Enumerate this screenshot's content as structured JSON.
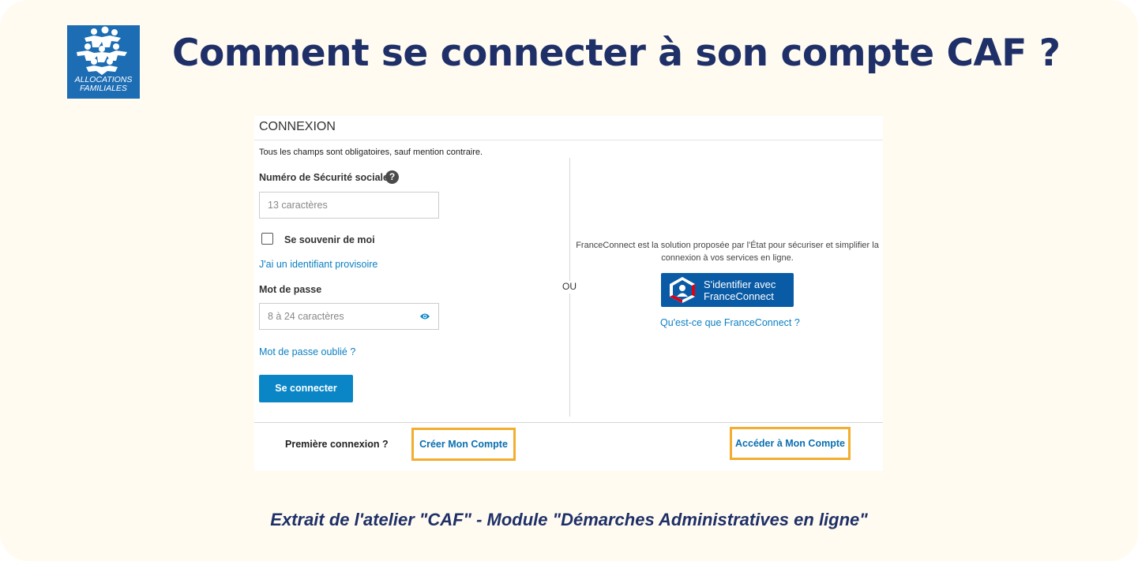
{
  "logo": {
    "line1": "ALLOCATIONS",
    "line2": "FAMILIALES",
    "brand_color": "#1d6db4"
  },
  "headline": "Comment se connecter à son compte CAF ?",
  "login": {
    "title": "CONNEXION",
    "mandatory_note": "Tous les champs sont obligatoires, sauf mention contraire.",
    "ssn_label": "Numéro de Sécurité sociale",
    "ssn_placeholder": "13 caractères",
    "help_icon": "question-circle-icon",
    "remember_label": "Se souvenir de moi",
    "temp_id_link": "J'ai un identifiant provisoire",
    "password_label": "Mot de passe",
    "password_placeholder": "8 à 24 caractères",
    "password_icon": "eye-icon",
    "forgot_link": "Mot de passe oublié ?",
    "submit_label": "Se connecter",
    "or_label": "OU"
  },
  "franceconnect": {
    "description": "FranceConnect est la solution proposée par l'État pour sécuriser et simplifier la connexion à vos services en ligne.",
    "button_line1": "S'identifier avec",
    "button_line2": "FranceConnect",
    "info_link": "Qu'est-ce que FranceConnect ?"
  },
  "footer": {
    "first_connection": "Première connexion ?",
    "create_account": "Créer Mon Compte",
    "access_account": "Accéder à Mon Compte",
    "highlight_color": "#f3ad2f"
  },
  "caption": "Extrait de l'atelier \"CAF\" - Module \"Démarches Administratives en ligne\""
}
